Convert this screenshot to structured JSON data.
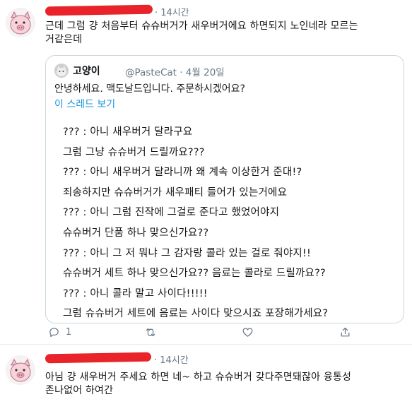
{
  "tweet1": {
    "time": "· 14시간",
    "text_line1": "근데 그럼 걍 처음부터 슈슈버거가 새우버거에요 하면되지 노인네라 모르는",
    "text_line2": "거같은데"
  },
  "quoted": {
    "name": "고양이",
    "handle": "@PasteCat · 4월 20일",
    "text": "안녕하세요. 맥도날드입니다. 주문하시겠어요?",
    "thread_link": "이 스레드 보기",
    "lines": [
      "??? : 아니 새우버거 달라구요",
      "그럼 그냥 슈슈버거 드릴까요???",
      "??? : 아니 새우버거 달라니까 왜 계속 이상한거 준대!?",
      "죄송하지만 슈슈버거가 새우패티 들어가 있는거에요",
      "??? : 아니 그럼 진작에 그걸로 준다고 했었어야지",
      "슈슈버거 단품 하나 맞으신가요??",
      "??? : 아니 그 저 뭐냐 그 감자랑 콜라 있는 걸로 줘야지!!",
      "슈슈버거 세트 하나 맞으신가요?? 음료는 콜라로 드릴까요??",
      "??? : 아니 콜라 말고 사이다!!!!!",
      "그럼 슈슈버거 세트에 음료는 사이다 맞으시죠 포장해가세요?"
    ]
  },
  "actions": {
    "reply_count": "1",
    "reply_icon": "reply-icon",
    "retweet_icon": "retweet-icon",
    "like_icon": "heart-icon",
    "share_icon": "share-icon"
  },
  "tweet2": {
    "time": "· 14시간",
    "text_line1": "아님 걍 새우버거 주세요 하면 네~ 하고 슈슈버거 갖다주면돼잖아 융통성",
    "text_line2": "존나없어 하여간"
  },
  "colors": {
    "redaction": "#e8232a",
    "link": "#1b95e0",
    "muted": "#657786"
  }
}
